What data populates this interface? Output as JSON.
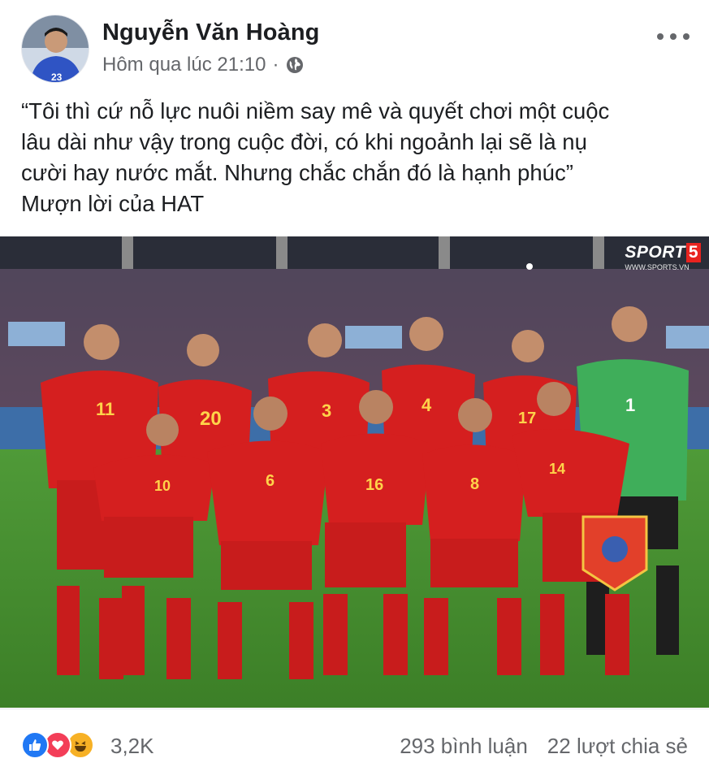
{
  "post": {
    "author": "Nguyễn Văn Hoàng",
    "timestamp": "Hôm qua lúc 21:10",
    "separator": "·",
    "privacy_icon": "globe-icon",
    "more_icon": "more-options-icon",
    "text_lines": [
      "“Tôi thì cứ nỗ lực nuôi niềm say mê và quyết chơi một cuộc",
      "lâu dài như vậy trong cuộc đời, có khi ngoảnh lại sẽ là nụ",
      "cười hay nước mắt. Nhưng chắc chắn đó là hạnh phúc”",
      "Mượn lời của HAT"
    ],
    "photo": {
      "watermark": "SPORT",
      "watermark_number": "5",
      "watermark_url": "WWW.SPORTS.VN",
      "jersey_numbers": [
        "11",
        "20",
        "3",
        "4",
        "17",
        "1",
        "10",
        "6",
        "16",
        "8",
        "14"
      ]
    }
  },
  "engagement": {
    "reaction_icons": [
      "like-icon",
      "love-icon",
      "haha-icon"
    ],
    "reaction_count": "3,2K",
    "comments": "293 bình luận",
    "shares": "22 lượt chia sẻ"
  },
  "colors": {
    "like": "#2078f4",
    "love": "#f33e58",
    "haha": "#f7b125",
    "jersey_red": "#d51f1f",
    "keeper_green": "#3fae5a",
    "pitch_green": "#3f8a2a"
  }
}
